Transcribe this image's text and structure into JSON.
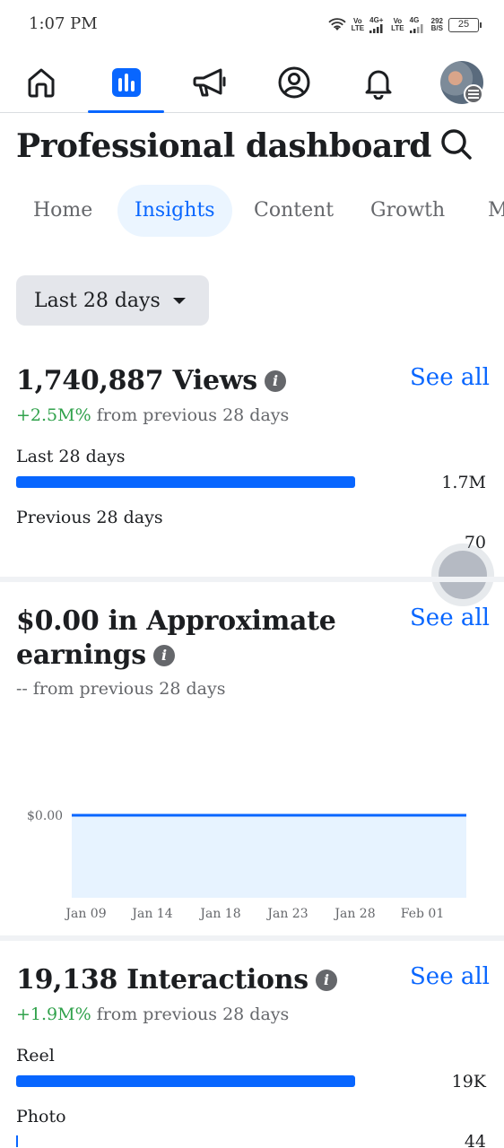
{
  "status_bar": {
    "time": "1:07 PM",
    "net1": "Vo\nLTE",
    "net1_gen": "4G+",
    "net2": "Vo\nLTE",
    "net2_gen": "4G",
    "speed": "292\nB/S",
    "battery": "25"
  },
  "nav": {
    "items": [
      {
        "name": "home-icon",
        "active": false
      },
      {
        "name": "insights-icon",
        "active": true
      },
      {
        "name": "megaphone-icon",
        "active": false
      },
      {
        "name": "profile-icon",
        "active": false
      },
      {
        "name": "bell-icon",
        "active": false
      }
    ],
    "accent_color": "#0866ff"
  },
  "header": {
    "title": "Professional dashboard"
  },
  "tabs": [
    {
      "label": "Home",
      "active": false
    },
    {
      "label": "Insights",
      "active": true
    },
    {
      "label": "Content",
      "active": false
    },
    {
      "label": "Growth",
      "active": false
    },
    {
      "label": "M",
      "active": false
    }
  ],
  "range": {
    "selected": "Last 28 days"
  },
  "views": {
    "title": "1,740,887 Views",
    "see_all": "See all",
    "delta_value": "+2.5M%",
    "delta_text": " from previous 28 days",
    "bars": [
      {
        "label": "Last 28 days",
        "value": "1.7M",
        "fraction": 1.0
      },
      {
        "label": "Previous 28 days",
        "value": "70",
        "fraction": 0.0
      }
    ]
  },
  "earnings": {
    "title_line1": "$0.00 in Approximate",
    "title_line2": "earnings",
    "see_all": "See all",
    "delta_text": "-- from previous 28 days"
  },
  "chart_data": {
    "type": "area",
    "x": [
      "Jan 09",
      "Jan 14",
      "Jan 18",
      "Jan 23",
      "Jan 28",
      "Feb 01"
    ],
    "y_ticks": [
      "$0.00"
    ],
    "series": [
      {
        "values": [
          0,
          0,
          0,
          0,
          0,
          0
        ]
      }
    ],
    "ylim": [
      0,
      0
    ],
    "color": "#0866ff",
    "fill": "#e7f3ff",
    "grid": false
  },
  "interactions": {
    "title": "19,138 Interactions",
    "see_all": "See all",
    "delta_value": "+1.9M%",
    "delta_text": " from previous 28 days",
    "bars": [
      {
        "label": "Reel",
        "value": "19K",
        "fraction": 1.0
      },
      {
        "label": "Photo",
        "value": "44",
        "fraction": 0.0
      }
    ]
  }
}
